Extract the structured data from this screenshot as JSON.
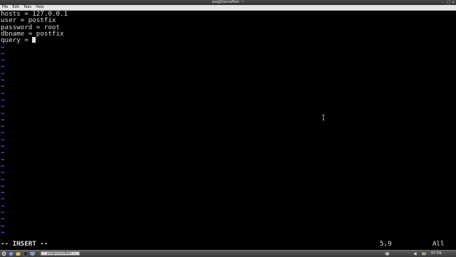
{
  "window": {
    "title": "joe@DemoMail: ~"
  },
  "menubar": {
    "items": [
      "File",
      "Edit",
      "Tabs",
      "Help"
    ]
  },
  "editor": {
    "lines": [
      "hosts = 127.0.0.1",
      "user = postfix",
      "password = root",
      "dbname = postfix",
      "query = "
    ],
    "empty_line_marker": "~",
    "mode": "-- INSERT --",
    "cursor_position": "5,9",
    "scroll_position": "All"
  },
  "taskbar": {
    "task_label": "joe@DemoMail: ~",
    "clock": "07:59"
  },
  "colors": {
    "background": "#000000",
    "text": "#d8d8d8",
    "tilde": "#5a64ff"
  }
}
